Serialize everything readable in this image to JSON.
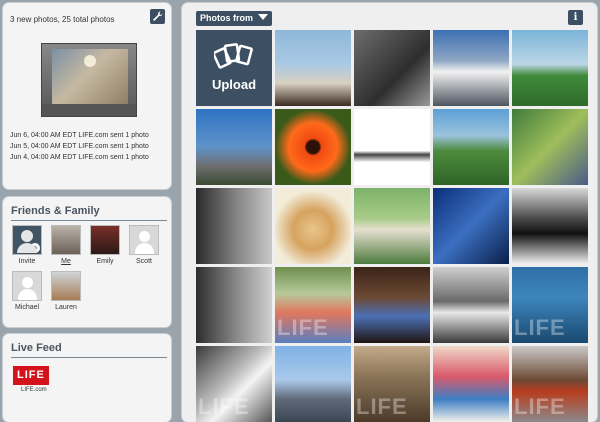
{
  "status": {
    "summary": "3 new photos, 25 total photos",
    "messages": [
      "Jun 6, 04:00 AM EDT LIFE.com sent 1 photo",
      "Jun 5, 04:00 AM EDT LIFE.com sent 1 photo",
      "Jun 4, 04:00 AM EDT LIFE.com sent 1 photo"
    ]
  },
  "friends": {
    "title": "Friends & Family",
    "items": [
      {
        "name": "Invite"
      },
      {
        "name": "Me"
      },
      {
        "name": "Emily"
      },
      {
        "name": "Scott"
      },
      {
        "name": "Michael"
      },
      {
        "name": "Lauren"
      }
    ]
  },
  "feed": {
    "title": "Live Feed",
    "logo": "LIFE",
    "logo_caption": "LIFE.com"
  },
  "photos": {
    "filter_label": "Photos from",
    "info_label": "i",
    "upload_label": "Upload",
    "watermark": "LIFE",
    "tiles": [
      "linear-gradient(#8fb7d9 0%, #a9c9e4 45%, #d9d0c0 70%, #3b2a22 100%)",
      "linear-gradient(135deg, #6d6d6d, #2e2e2e 60%, #9a9a9a)",
      "linear-gradient(#3d6fb3 0%, #8ea7c4 40%, #f2f2f2 55%, #4d5560 100%)",
      "linear-gradient(#7ab4d8 0%, #bcd6e6 45%, #3f8a3a 60%, #2f6b2a 100%)",
      "linear-gradient(#2f73c3 0%, #5f93c9 50%, #6f6f6f 75%, #3a4a33 100%)",
      "radial-gradient(circle at 50% 50%, #2b1205 0%, #2b1205 12%, #f04a12 16%, #ff6a1a 45%, #3a5a1a 70%)",
      "linear-gradient(#ffffff 0%, #ffffff 55%, #444 60%, #ffffff 70%)",
      "linear-gradient(#5ba0d6 0%, #9cc2dc 35%, #4d8b3d 55%, #2e6426 100%)",
      "linear-gradient(135deg, #3f7b3c, #9fbe5a 50%, #4a5a8a)",
      "linear-gradient(90deg, #2a2a2a, #7f7f7f 50%, #c8c8c8)",
      "radial-gradient(circle at 50% 55%, #e9c58b 0%, #d6a35f 35%, #f2ecd9 70%)",
      "linear-gradient(#7db26a 0%, #a8cc88 40%, #e6e0cf 55%, #4c7a3d 100%)",
      "linear-gradient(135deg, #0c2f7a, #3b6fc0 50%, #0a1f4a)",
      "linear-gradient(#d8d8d8 0%, #4a4a4a 40%, #111 60%, #f1f1f1 100%)",
      "linear-gradient(90deg, #2d2d2d, #8c8c8c 55%, #d0d0d0)",
      "linear-gradient(#6e8f4e 0%, #b6c99a 35%, #e0775f 60%, #5c7fbf 100%)",
      "linear-gradient(#3b2418 0%, #6c4a34 40%, #4b6fb5 65%, #201510 100%)",
      "linear-gradient(#cfcfcf 0%, #6a6a6a 45%, #e8e8e8 60%, #3a3a3a 100%)",
      "linear-gradient(#2f6fa6 0%, #3d85bd 40%, #19496f 100%)",
      "linear-gradient(135deg, #3a3a3a, #bdbdbd 45%, #f4f4f4 60%, #555)",
      "linear-gradient(#7fb2e6 0%, #a9c9ea 45%, #606a78 70%, #3b4654 100%)",
      "linear-gradient(#c2aa8a 0%, #8b7457 40%, #4c3a29 100%)",
      "linear-gradient(#f0d8c8 0%, #d95a6a 40%, #3d7ec4 70%, #f3f0ea 100%)",
      "linear-gradient(#c9c9c9 0%, #6d4a33 45%, #b83d1f 60%, #8a8a8a 100%)"
    ]
  }
}
